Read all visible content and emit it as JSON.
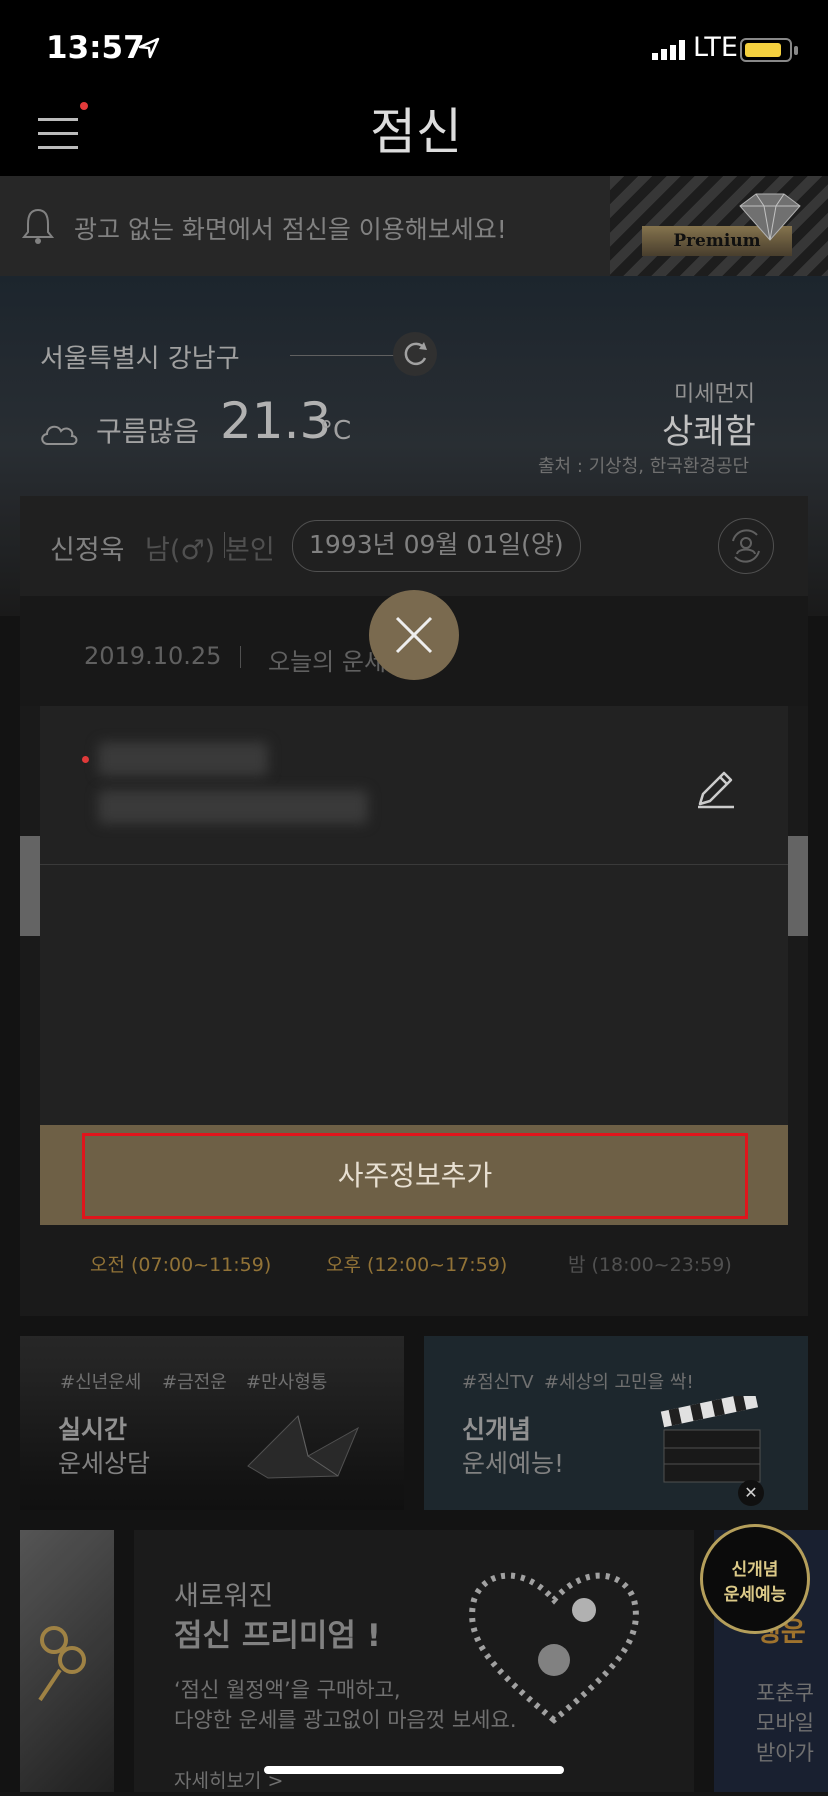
{
  "status": {
    "time": "13:57",
    "network": "LTE"
  },
  "header": {
    "logo": "점신"
  },
  "adbar": {
    "text": "광고 없는 화면에서 점신을 이용해보세요!",
    "badge": "Premium"
  },
  "weather": {
    "location": "서울특별시 강남구",
    "condition": "구름많음",
    "temperature": "21.3",
    "unit": "°C",
    "dust_label": "미세먼지",
    "dust_value": "상쾌함",
    "source": "출처 : 기상청, 한국환경공단"
  },
  "user": {
    "name": "신정욱",
    "gender": "남(♂)",
    "relation": "본인",
    "birth": "1993년 09월 01일(양)"
  },
  "daterow": {
    "date": "2019.10.25",
    "today": "오늘의 운세"
  },
  "timezones": [
    "오전 (07:00~11:59)",
    "오후 (12:00~17:59)",
    "밤 (18:00~23:59)"
  ],
  "cards": [
    {
      "tags": [
        "#신년운세",
        "#금전운",
        "#만사형통"
      ],
      "title": "실시간",
      "subtitle": "운세상담"
    },
    {
      "tags": [
        "#점신TV",
        "#세상의 고민을 싹!"
      ],
      "title": "신개념",
      "subtitle": "운세예능!",
      "close": "✕"
    }
  ],
  "promo": {
    "title1": "새로워진",
    "title2": "점신 프리미엄 !",
    "desc1": "‘점신 월정액’을 구매하고,",
    "desc2": "다양한 운세를 광고없이 마음껏 보세요.",
    "more": "자세히보기 >"
  },
  "promo_right": {
    "title": "행운",
    "text": "포춘쿠\n모바일\n받아가"
  },
  "badge": {
    "line1": "신개념",
    "line2": "운세예능"
  },
  "modal": {
    "button": "사주정보추가"
  }
}
